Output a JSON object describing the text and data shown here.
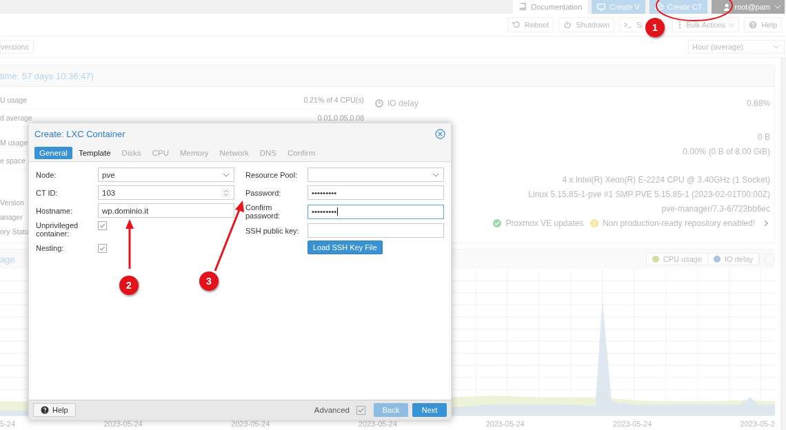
{
  "top_bar": {
    "buttons": [
      {
        "label": "Documentation",
        "kind": "doc"
      },
      {
        "label": "Create V",
        "kind": "vm"
      },
      {
        "label": "Create CT",
        "kind": "ct"
      }
    ],
    "user": "root@pam"
  },
  "toolbar": {
    "buttons": [
      {
        "label": "Reboot",
        "kind": "reboot"
      },
      {
        "label": "Shutdown",
        "kind": "power"
      },
      {
        "label": "S",
        "kind": "shell"
      },
      {
        "label": "Bulk Actions",
        "kind": "bulk"
      },
      {
        "label": "Help",
        "kind": "help"
      }
    ]
  },
  "view_bar": {
    "button": "versions",
    "timeframe": "Hour (average)"
  },
  "status_panel": {
    "title": "time: 57 days 10:36:47)",
    "left": [
      {
        "label": "U usage",
        "value": "0.21% of 4 CPU(s)"
      },
      {
        "label": "d average",
        "value": "0.01,0.05,0.08"
      },
      {
        "label": "M usage"
      },
      {
        "label": "e space"
      },
      {
        "label": "Version"
      },
      {
        "label": "anager"
      },
      {
        "label": "ory Statu"
      }
    ],
    "right": [
      {
        "label": "IO delay",
        "value": "0.68%"
      },
      {
        "value": "0 B"
      },
      {
        "value": "0.00% (0 B of 8.00 GiB)"
      },
      {
        "value": "4 x Intel(R) Xeon(R) E-2224 CPU @ 3.40GHz (1 Socket)"
      },
      {
        "value": "Linux 5.15.85-1-pve #1 SMP PVE 5.15.85-1 (2023-02-01T00:00Z)"
      },
      {
        "value": "pve-manager/7.3-6/723bb6ec"
      }
    ],
    "repo_status": [
      {
        "label": "Proxmox VE updates",
        "kind": "ok"
      },
      {
        "label": "Non production-ready repository enabled!",
        "kind": "warn"
      }
    ]
  },
  "chart_panel": {
    "title": "age",
    "legend": [
      {
        "label": "CPU usage",
        "color": "#d4dea0"
      },
      {
        "label": "IO delay",
        "color": "#a9c4de"
      }
    ],
    "x_labels": [
      "5-24",
      "2023-05-24",
      "2023-05-24",
      "2023-05-24",
      "2023-05-24",
      "2023-05-24",
      "2023-05-2"
    ]
  },
  "dialog": {
    "title": "Create: LXC Container",
    "tabs": [
      {
        "label": "General",
        "selected": true,
        "disabled": false
      },
      {
        "label": "Template",
        "selected": false,
        "disabled": false
      },
      {
        "label": "Disks",
        "selected": false,
        "disabled": true
      },
      {
        "label": "CPU",
        "selected": false,
        "disabled": true
      },
      {
        "label": "Memory",
        "selected": false,
        "disabled": true
      },
      {
        "label": "Network",
        "selected": false,
        "disabled": true
      },
      {
        "label": "DNS",
        "selected": false,
        "disabled": true
      },
      {
        "label": "Confirm",
        "selected": false,
        "disabled": true
      }
    ],
    "left_fields": [
      {
        "label": "Node:",
        "kind": "select",
        "value": "pve"
      },
      {
        "label": "CT ID:",
        "kind": "spinner",
        "value": "103"
      },
      {
        "label": "Hostname:",
        "kind": "text",
        "value": "wp.dominio.it"
      },
      {
        "label": "Unprivileged container:",
        "kind": "checkbox",
        "checked": true
      },
      {
        "label": "Nesting:",
        "kind": "checkbox",
        "checked": true
      }
    ],
    "right_fields": [
      {
        "label": "Resource Pool:",
        "kind": "select",
        "focused": false
      },
      {
        "label": "Password:",
        "kind": "text",
        "value": "•••••••••",
        "focused": false
      },
      {
        "label": "Confirm password:",
        "kind": "text",
        "value": "•••••••••",
        "focused": true
      },
      {
        "label": "SSH public key:",
        "kind": "text",
        "focused": false
      }
    ],
    "load_button": "Load SSH Key File",
    "help_button": "Help",
    "advanced": {
      "label": "Advanced",
      "checked": true
    },
    "back_button": {
      "label": "Back",
      "disabled": true
    },
    "next_button": {
      "label": "Next",
      "disabled": false
    }
  },
  "annotations": [
    {
      "label": "1"
    },
    {
      "label": "2"
    },
    {
      "label": "3"
    }
  ]
}
